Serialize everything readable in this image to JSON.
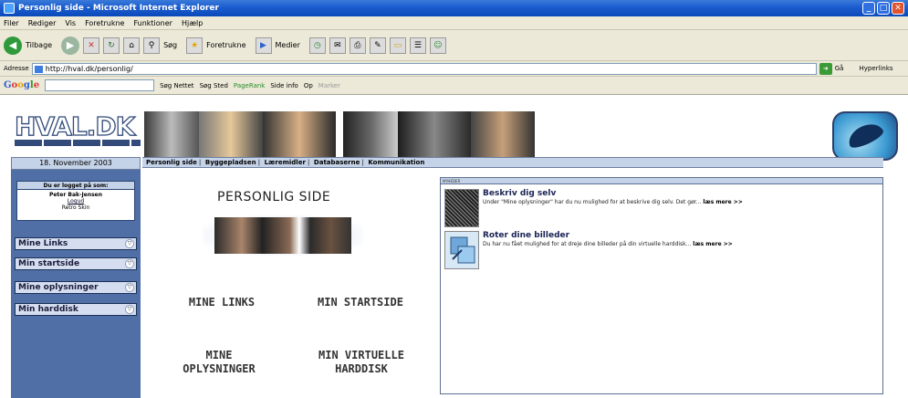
{
  "window": {
    "title": "Personlig side - Microsoft Internet Explorer"
  },
  "menu": [
    "Filer",
    "Rediger",
    "Vis",
    "Foretrukne",
    "Funktioner",
    "Hjælp"
  ],
  "toolbar": {
    "back_label": "Tilbage",
    "search_label": "Søg",
    "favorites_label": "Foretrukne",
    "media_label": "Medier"
  },
  "address": {
    "label": "Adresse",
    "value": "http://hval.dk/personlig/",
    "go_label": "Gå",
    "links_label": "Hyperlinks"
  },
  "googlebar": {
    "logo_parts": [
      "G",
      "o",
      "o",
      "g",
      "l",
      "e"
    ],
    "search_web": "Søg Nettet",
    "search_site": "Søg Sted",
    "pagerank": "PageRank",
    "page_info": "Side info",
    "up": "Op",
    "highlight": "Marker"
  },
  "site": {
    "logo": "HVAL.DK",
    "date": "18. November 2003",
    "nav": [
      "Personlig side",
      "Byggepladsen",
      "Læremidler",
      "Databaserne",
      "Kommunikation"
    ],
    "login": {
      "title": "Du er logget på som:",
      "name": "Peter Bak-Jensen",
      "logout": "Logud",
      "skin": "Retro Skin"
    },
    "sidebar": [
      "Mine Links",
      "Min startside",
      "Mine oplysninger",
      "Min harddisk"
    ],
    "main": {
      "title": "PERSONLIG SIDE",
      "links": [
        "MINE LINKS",
        "MIN STARTSIDE",
        "MINE\nOPLYSNINGER",
        "MIN VIRTUELLE\nHARDDISK"
      ]
    },
    "news": {
      "header": "NYHEDER",
      "items": [
        {
          "title": "Beskriv dig selv",
          "desc": "Under \"Mine oplysninger\" har du nu mulighed for at beskrive dig selv. Det gør...",
          "more": "læs mere >>"
        },
        {
          "title": "Roter dine billeder",
          "desc": "Du har nu fået mulighed for at dreje dine billeder på din virtuelle harddisk...",
          "more": "læs mere >>"
        }
      ]
    }
  },
  "colors": {
    "accent": "#4f6fa6",
    "light_accent": "#c5d3e8",
    "titlebar": "#0a49b9"
  }
}
